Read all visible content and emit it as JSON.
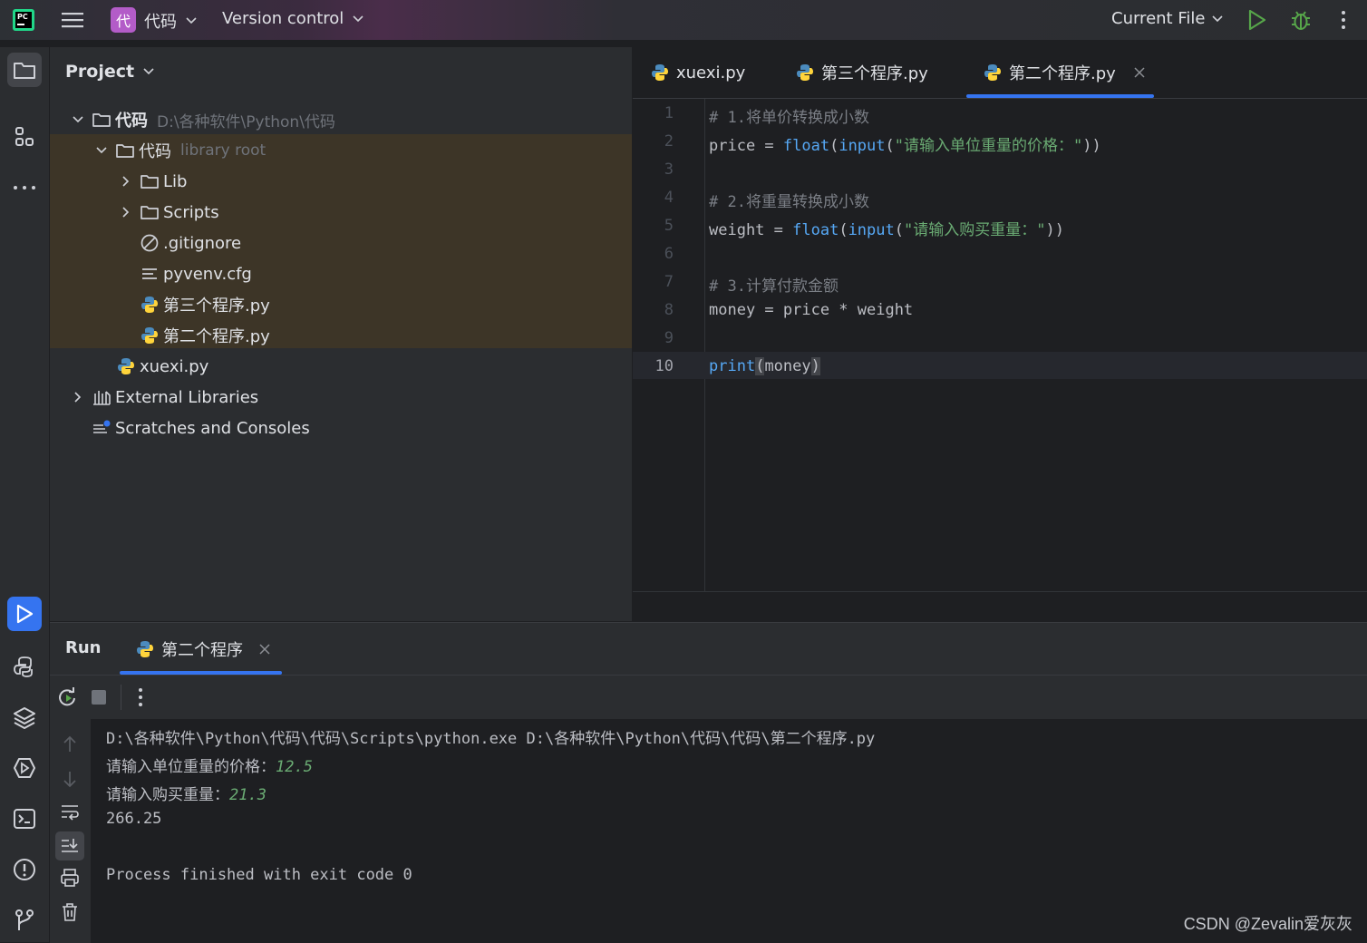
{
  "titlebar": {
    "project_badge": "代",
    "project_name": "代码",
    "vcs_label": "Version control",
    "run_config": "Current File"
  },
  "project_panel": {
    "title": "Project",
    "tree": [
      {
        "label": "代码",
        "hint": "D:\\各种软件\\Python\\代码"
      },
      {
        "label": "代码",
        "hint": "library root"
      },
      {
        "label": "Lib"
      },
      {
        "label": "Scripts"
      },
      {
        "label": ".gitignore"
      },
      {
        "label": "pyvenv.cfg"
      },
      {
        "label": "第三个程序.py"
      },
      {
        "label": "第二个程序.py"
      },
      {
        "label": "xuexi.py"
      },
      {
        "label": "External Libraries"
      },
      {
        "label": "Scratches and Consoles"
      }
    ]
  },
  "editor": {
    "tabs": [
      {
        "label": "xuexi.py"
      },
      {
        "label": "第三个程序.py"
      },
      {
        "label": "第二个程序.py",
        "active": true
      }
    ],
    "line_numbers": [
      "1",
      "2",
      "3",
      "4",
      "5",
      "6",
      "7",
      "8",
      "9",
      "10"
    ],
    "lines": {
      "l1": "# 1.将单价转换成小数",
      "l2_a": "price = ",
      "l2_fn": "float",
      "l2_b": "(",
      "l2_fn2": "input",
      "l2_c": "(",
      "l2_str": "\"请输入单位重量的价格：\"",
      "l2_d": "))",
      "l4": "# 2.将重量转换成小数",
      "l5_a": "weight = ",
      "l5_fn": "float",
      "l5_b": "(",
      "l5_fn2": "input",
      "l5_c": "(",
      "l5_str": "\"请输入购买重量：\"",
      "l5_d": "))",
      "l7": "# 3.计算付款金额",
      "l8": "money = price * weight",
      "l10_fn": "print",
      "l10_a": "(",
      "l10_b": "money",
      "l10_c": ")"
    }
  },
  "run_panel": {
    "title": "Run",
    "tab_label": "第二个程序",
    "console": {
      "cmd": "D:\\各种软件\\Python\\代码\\代码\\Scripts\\python.exe D:\\各种软件\\Python\\代码\\代码\\第二个程序.py",
      "prompt1": "请输入单位重量的价格：",
      "input1": "12.5",
      "prompt2": "请输入购买重量：",
      "input2": "21.3",
      "result": "266.25",
      "exit": "Process finished with exit code 0"
    }
  },
  "watermark": "CSDN @Zevalin爱灰灰",
  "colors": {
    "accent": "#3574f0",
    "run_green": "#57a64a",
    "tree_highlight": "#3d3527"
  }
}
